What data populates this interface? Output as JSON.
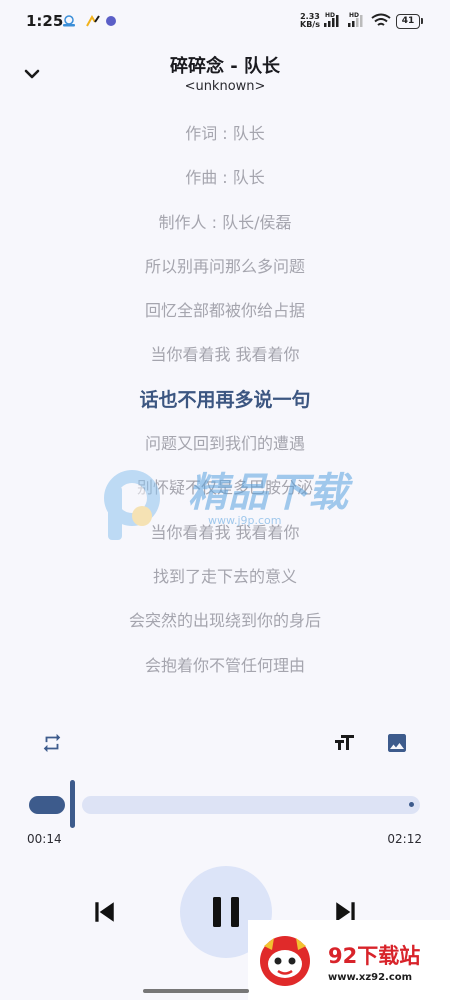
{
  "status_bar": {
    "time": "1:25",
    "net_speed_value": "2.33",
    "net_speed_unit": "KB/s",
    "hd_label": "HD",
    "battery": "41"
  },
  "header": {
    "title": "碎碎念 - 队长",
    "artist": "<unknown>"
  },
  "lyrics": {
    "lines": [
      "作词 : 队长",
      "作曲 : 队长",
      "制作人 : 队长/侯磊",
      "所以别再问那么多问题",
      "回忆全部都被你给占据",
      "当你看着我 我看着你",
      "话也不用再多说一句",
      "问题又回到我们的遭遇",
      "别怀疑不仅是多巴胺分泌",
      "当你看着我 我看着你",
      "找到了走下去的意义",
      "会突然的出现绕到你的身后",
      "会抱着你不管任何理由"
    ],
    "active_index": 6
  },
  "watermark": {
    "name": "精品下载",
    "url": "www.j9p.com"
  },
  "player": {
    "current_time": "00:14",
    "total_time": "02:12",
    "progress_fraction": 0.106,
    "state": "playing"
  },
  "brand_badge": {
    "name": "92下载站",
    "url": "www.xz92.com"
  },
  "icons": {
    "back": "chevron-down-icon",
    "repeat": "repeat-icon",
    "font_size": "text-size-icon",
    "background": "image-icon",
    "previous": "skip-previous-icon",
    "pause": "pause-icon",
    "next": "skip-next-icon"
  },
  "colors": {
    "accent": "#3d5b8c",
    "active_lyric": "#3c5681",
    "inactive_lyric": "#a5a5ae",
    "track": "#dde3f5",
    "play_button": "#dce4f8",
    "background": "#f7f7fc"
  }
}
